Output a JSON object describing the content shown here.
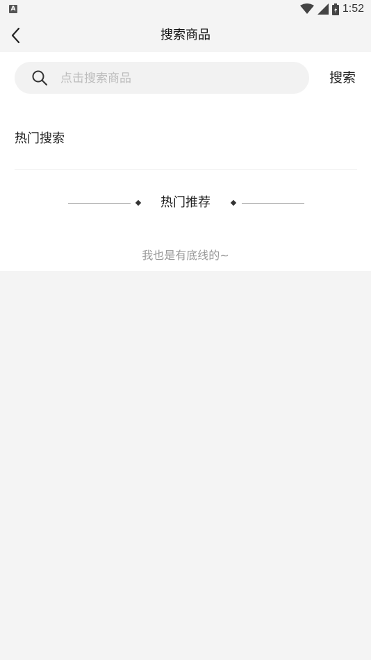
{
  "status_bar": {
    "indicator": "A",
    "time": "1:52",
    "icons": [
      "wifi-icon",
      "cellular-signal-icon",
      "battery-icon"
    ]
  },
  "nav": {
    "title": "搜索商品",
    "back_icon": "chevron-left-icon"
  },
  "search": {
    "placeholder": "点击搜索商品",
    "value": "",
    "button_label": "搜索",
    "icon": "search-icon"
  },
  "hot_search": {
    "title": "热门搜索"
  },
  "recommend": {
    "title": "热门推荐"
  },
  "footer": {
    "end_text": "我也是有底线的~"
  },
  "colors": {
    "page_background": "#f4f4f4",
    "content_background": "#ffffff",
    "search_box": "#f2f2f2",
    "placeholder": "#bdbdbd",
    "muted_text": "#999999"
  }
}
